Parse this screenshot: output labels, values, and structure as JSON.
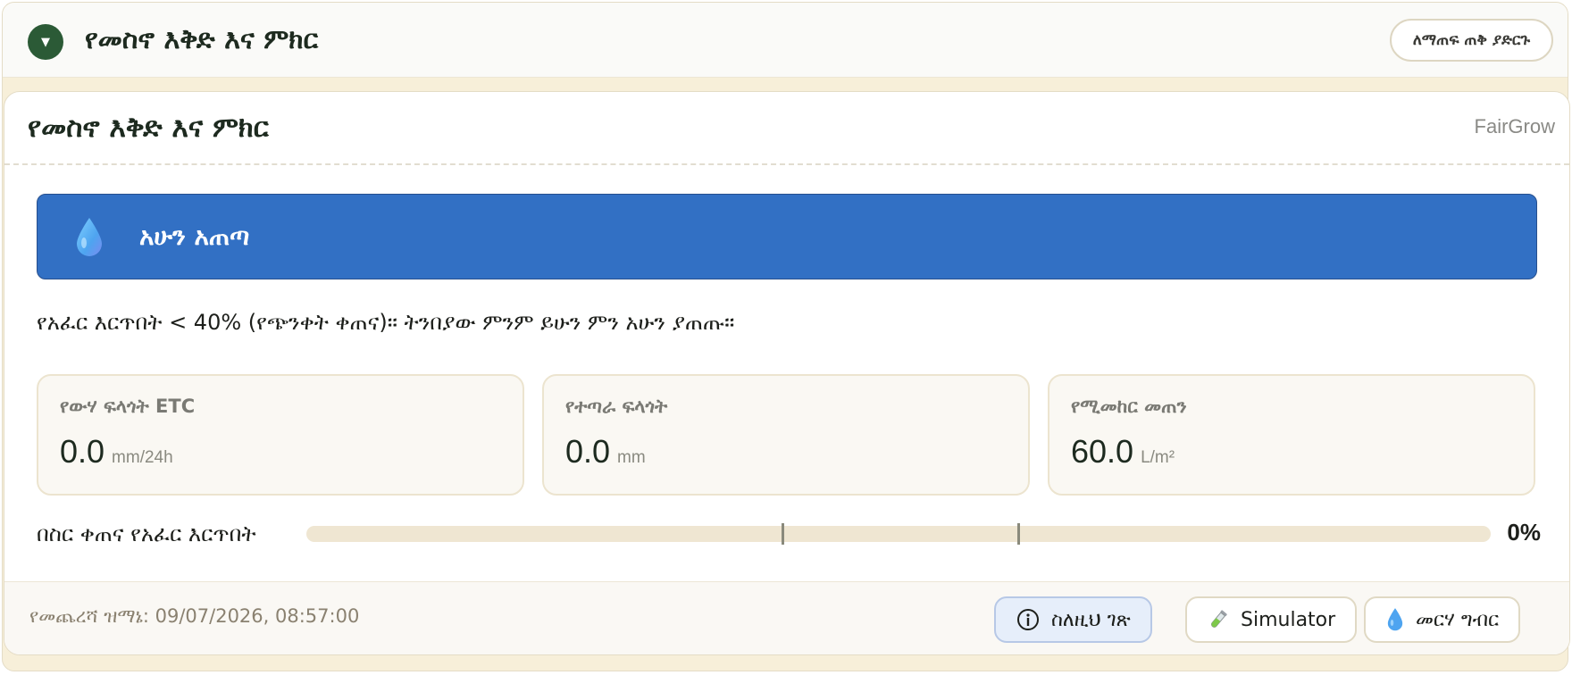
{
  "topbar": {
    "toggle_icon": "▼",
    "title": "የመስኖ እቅድ እና ምክር",
    "print_label": "ለማጠፍ ጠቅ ያድርጉ"
  },
  "card": {
    "title": "የመስኖ እቅድ እና ምክር",
    "brand": "FairGrow"
  },
  "alert": {
    "icon": "water-drop-icon",
    "title": "አሁን አጠጣ",
    "color": "#3270c4"
  },
  "advice": "የአፈር እርጥበት < 40% (የጭንቀት ቀጠና)። ትንበያው ምንም ይሁን ምን አሁን ያጠጡ።",
  "metrics": [
    {
      "label": "የውሃ ፍላጎት ETC",
      "value": "0.0",
      "unit": "mm/24h"
    },
    {
      "label": "የተጣራ ፍላጎት",
      "value": "0.0",
      "unit": "mm"
    },
    {
      "label": "የሚመከር መጠን",
      "value": "60.0",
      "unit": "L/m²"
    }
  ],
  "moisture": {
    "label": "በስር ቀጠና የአፈር እርጥበት",
    "value_text": "0%",
    "fraction": 0
  },
  "footer": {
    "last_updated": "የመጨረሻ ዝማኔ: 09/07/2026, 08:57:00",
    "about_label": "ስለዚህ ገጽ",
    "simulator_label": "Simulator",
    "guide_label": "መርሃ ግብር"
  }
}
